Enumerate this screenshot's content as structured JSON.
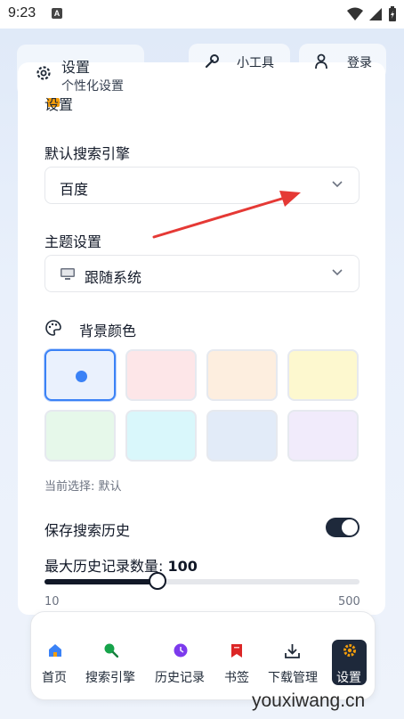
{
  "status_bar": {
    "time": "9:23",
    "notification_letter": "A"
  },
  "header": {
    "title": "设置",
    "subtitle": "个性化设置",
    "tools_label": "小工具",
    "login_label": "登录"
  },
  "card": {
    "peek_title": "设置",
    "search_engine": {
      "label": "默认搜索引擎",
      "value": "百度"
    },
    "theme": {
      "label": "主题设置",
      "value": "跟随系统"
    },
    "background": {
      "label": "背景颜色",
      "swatches": [
        "#eaf1fd",
        "#fde6e8",
        "#fdeedf",
        "#fdf8cf",
        "#e6f8ea",
        "#d9f7fb",
        "#e2ebf8",
        "#f1ebfb"
      ],
      "current_label": "当前选择: 默认"
    },
    "save_history": {
      "label": "保存搜索历史",
      "enabled": true
    },
    "max_history": {
      "label_prefix": "最大历史记录数量: ",
      "value": "100",
      "min": "10",
      "max": "500"
    }
  },
  "nav": {
    "items": [
      {
        "label": "首页",
        "icon": "home-icon"
      },
      {
        "label": "搜索引擎",
        "icon": "search-icon"
      },
      {
        "label": "历史记录",
        "icon": "history-icon"
      },
      {
        "label": "书签",
        "icon": "bookmark-icon"
      },
      {
        "label": "下载管理",
        "icon": "download-icon"
      },
      {
        "label": "设置",
        "icon": "gear-icon"
      }
    ],
    "active_index": 5
  },
  "watermark": "youxiwang.cn",
  "colors": {
    "accent": "#3b82f6",
    "dark": "#1e293b",
    "arrow": "#e53935"
  }
}
